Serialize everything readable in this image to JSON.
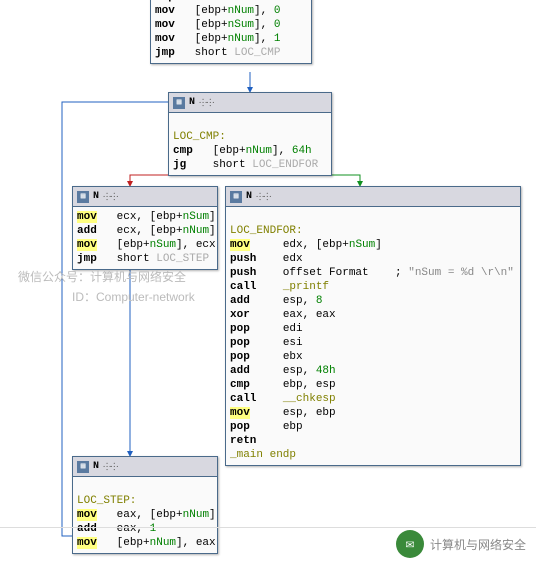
{
  "top_block": {
    "lines": [
      {
        "op": "rep",
        "rest": " stosd"
      },
      {
        "op": "mov",
        "rest": "   [ebp+",
        "var": "nNum",
        "tail": "], ",
        "val": "0"
      },
      {
        "op": "mov",
        "rest": "   [ebp+",
        "var": "nSum",
        "tail": "], ",
        "val": "0"
      },
      {
        "op": "mov",
        "rest": "   [ebp+",
        "var": "nNum",
        "tail": "], ",
        "val": "1"
      },
      {
        "op": "jmp",
        "rest": "   short ",
        "target": "LOC_CMP"
      }
    ]
  },
  "cmp_block": {
    "title": "N",
    "lines": [
      {
        "label": "LOC_CMP:"
      },
      {
        "op": "cmp",
        "rest": "   [ebp+",
        "var": "nNum",
        "tail": "], ",
        "val": "64h"
      },
      {
        "op": "jg",
        "rest": "    short ",
        "target": "LOC_ENDFOR"
      }
    ]
  },
  "sum_block": {
    "title": "N",
    "lines": [
      {
        "op": "mov",
        "hl": true,
        "rest": "   ecx, [ebp+",
        "var": "nSum",
        "tail": "]"
      },
      {
        "op": "add",
        "rest": "   ecx, [ebp+",
        "var": "nNum",
        "tail": "]"
      },
      {
        "op": "mov",
        "hl": true,
        "rest": "   [ebp+",
        "var": "nSum",
        "tail": "], ecx"
      },
      {
        "op": "jmp",
        "rest": "   short ",
        "target": "LOC_STEP"
      }
    ]
  },
  "end_block": {
    "title": "N",
    "lines": [
      {
        "label": "LOC_ENDFOR:"
      },
      {
        "op": "mov",
        "hl": true,
        "rest": "     edx, [ebp+",
        "var": "nSum",
        "tail": "]"
      },
      {
        "op": "push",
        "rest": "    edx"
      },
      {
        "op": "push",
        "rest": "    offset Format    ; ",
        "cmt": "\"nSum = %d \\r\\n\""
      },
      {
        "op": "call",
        "rest": "    ",
        "proc": "_printf"
      },
      {
        "op": "add",
        "rest": "     esp, ",
        "val": "8"
      },
      {
        "op": "xor",
        "rest": "     eax, eax"
      },
      {
        "op": "pop",
        "rest": "     edi"
      },
      {
        "op": "pop",
        "rest": "     esi"
      },
      {
        "op": "pop",
        "rest": "     ebx"
      },
      {
        "op": "add",
        "rest": "     esp, ",
        "val": "48h"
      },
      {
        "op": "cmp",
        "rest": "     ebp, esp"
      },
      {
        "op": "call",
        "rest": "    ",
        "proc": "__chkesp"
      },
      {
        "op": "mov",
        "hl": true,
        "rest": "     esp, ebp"
      },
      {
        "op": "pop",
        "rest": "     ebp"
      },
      {
        "op": "retn"
      },
      {
        "endp": "_main endp"
      }
    ]
  },
  "step_block": {
    "title": "N",
    "lines": [
      {
        "label": "LOC_STEP:"
      },
      {
        "op": "mov",
        "hl": true,
        "rest": "   eax, [ebp+",
        "var": "nNum",
        "tail": "]"
      },
      {
        "op": "add",
        "rest": "   eax, ",
        "val": "1"
      },
      {
        "op": "mov",
        "hl": true,
        "rest": "   [ebp+",
        "var": "nNum",
        "tail": "], eax"
      }
    ]
  },
  "watermark1": "微信公众号：计算机与网络安全",
  "watermark2": "ID：Computer-network",
  "footer": "计算机与网络安全"
}
